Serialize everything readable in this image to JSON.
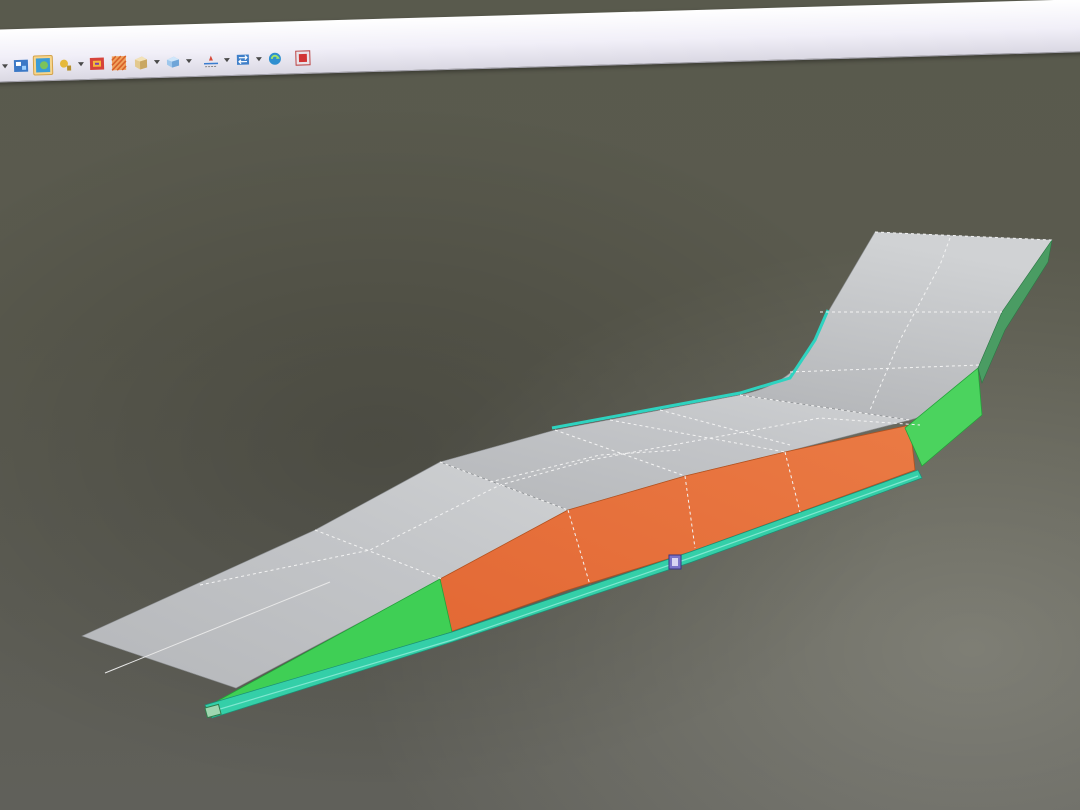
{
  "window": {
    "colors": {
      "toolbar_bg": "#f1eff8",
      "viewport_bg": "#5a5a4e",
      "surface_gray": "#b9bcbf",
      "face_orange": "#e5703c",
      "face_green": "#3fcf55",
      "edge_cyan": "#2ed3c0"
    }
  },
  "toolbar": {
    "buttons": [
      {
        "name": "view-mode-dropdown-icon",
        "color": "#6a6a6a"
      },
      {
        "name": "render-style-icon",
        "color": "#3b78c6"
      },
      {
        "name": "display-mode-icon",
        "color": "#3b9bd6",
        "active": true
      },
      {
        "name": "lighting-icon",
        "color": "#b8912d"
      },
      {
        "name": "section-view-icon",
        "color": "#d6433b"
      },
      {
        "name": "texture-icon",
        "color": "#d7602a"
      },
      {
        "name": "box-solid-icon",
        "color": "#c9a763"
      },
      {
        "name": "part-icon",
        "color": "#6fa5d8"
      },
      {
        "name": "dimension-icon",
        "color": "#d74a3a"
      },
      {
        "name": "transform-icon",
        "color": "#3f7fc9"
      },
      {
        "name": "sync-icon",
        "color": "#2f8fd0"
      },
      {
        "name": "stop-render-icon",
        "color": "#d13434"
      }
    ]
  }
}
